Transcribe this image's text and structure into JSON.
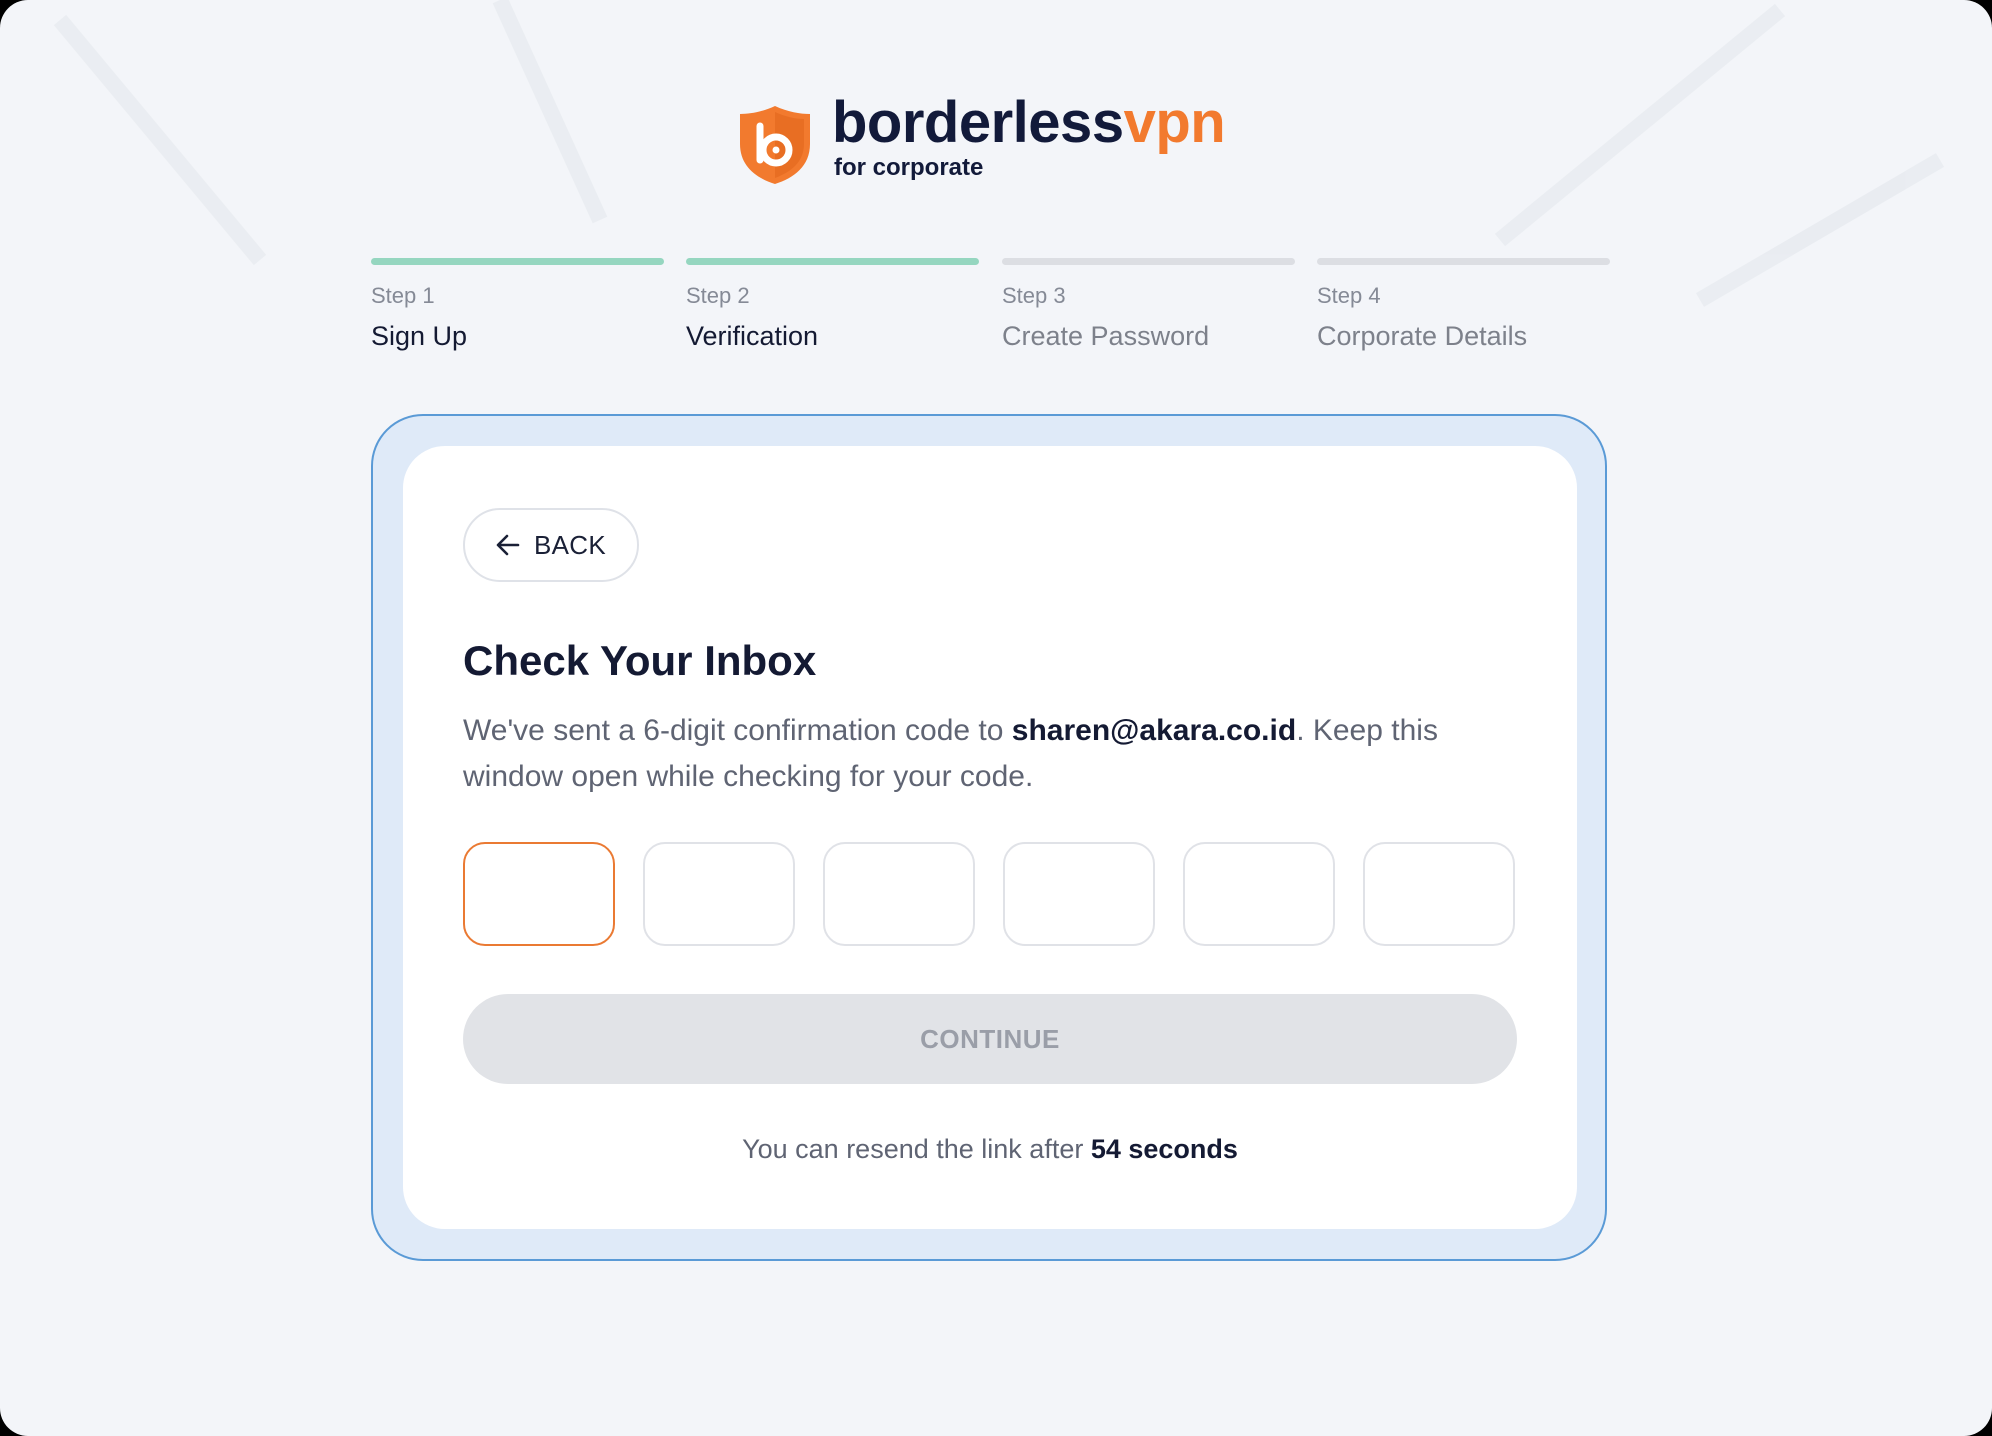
{
  "brand": {
    "name_main": "borderless",
    "name_accent": "vpn",
    "tagline": "for corporate",
    "colors": {
      "accent": "#f27a2e",
      "navy": "#121a3a"
    }
  },
  "stepper": {
    "steps": [
      {
        "number": "Step 1",
        "title": "Sign Up",
        "status": "complete"
      },
      {
        "number": "Step 2",
        "title": "Verification",
        "status": "complete"
      },
      {
        "number": "Step 3",
        "title": "Create Password",
        "status": "pending"
      },
      {
        "number": "Step 4",
        "title": "Corporate Details",
        "status": "pending"
      }
    ],
    "colors": {
      "complete": "#95d6c0",
      "pending": "#dcdee3"
    }
  },
  "card": {
    "back_label": "BACK",
    "back_icon": "arrow-left-icon",
    "title": "Check Your Inbox",
    "desc_prefix": "We've sent a 6-digit confirmation code to ",
    "email": "sharen@akara.co.id",
    "desc_suffix": ". Keep this window open while checking for your code.",
    "otp": {
      "digits": [
        "",
        "",
        "",
        "",
        "",
        ""
      ],
      "active_index": 0,
      "active_color": "#ea7a33"
    },
    "continue_label": "CONTINUE",
    "continue_disabled": true,
    "resend_prefix": "You can resend the link after ",
    "resend_countdown": "54 seconds"
  }
}
